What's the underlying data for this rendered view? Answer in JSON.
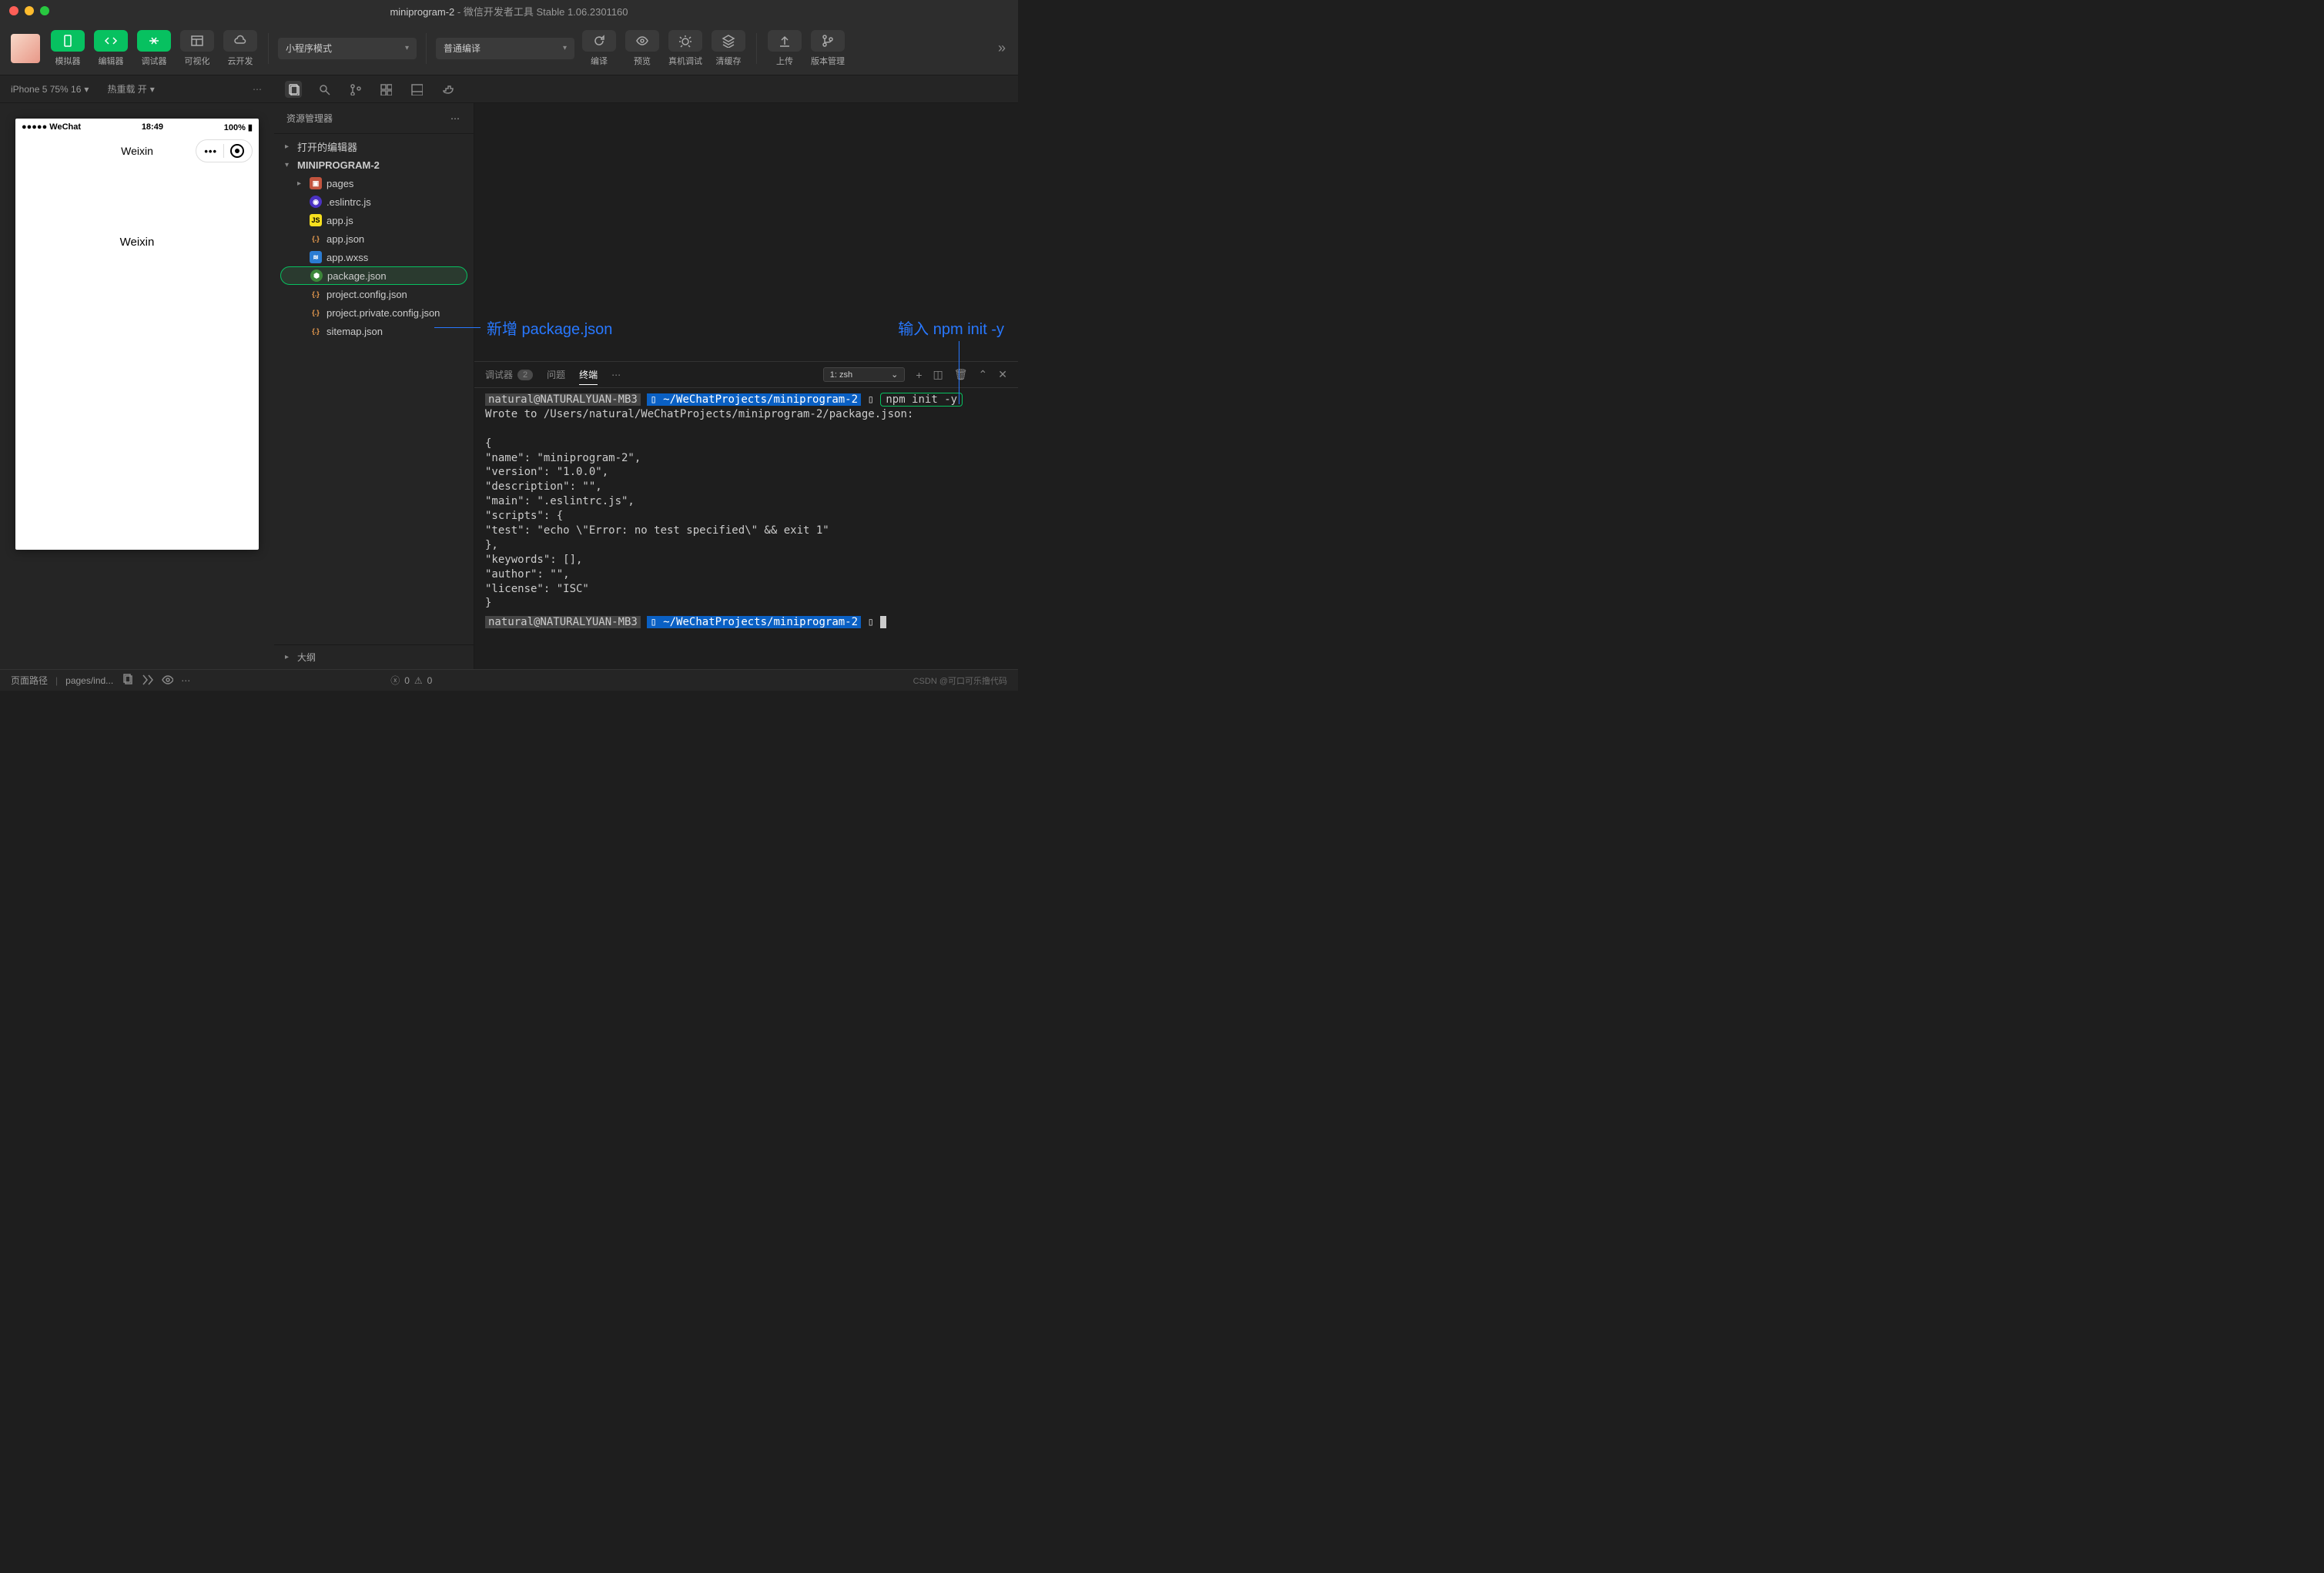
{
  "window": {
    "title_project": "miniprogram-2",
    "title_app": "微信开发者工具 Stable 1.06.2301160"
  },
  "toolbar": {
    "simulator": "模拟器",
    "editor": "编辑器",
    "debugger": "调试器",
    "visualize": "可视化",
    "cloud": "云开发",
    "mode_select": "小程序模式",
    "compile_select": "普通编译",
    "compile": "编译",
    "preview": "预览",
    "remote_debug": "真机调试",
    "clear_cache": "清缓存",
    "upload": "上传",
    "version_manage": "版本管理"
  },
  "subbar": {
    "device": "iPhone 5 75% 16",
    "hot_reload": "热重载 开"
  },
  "explorer": {
    "title": "资源管理器",
    "open_editors": "打开的编辑器",
    "project_root": "MINIPROGRAM-2",
    "outline": "大纲",
    "tree": [
      {
        "name": "pages",
        "icon": "folder",
        "kind": "dir"
      },
      {
        "name": ".eslintrc.js",
        "icon": "eslint",
        "kind": "file"
      },
      {
        "name": "app.js",
        "icon": "js",
        "kind": "file"
      },
      {
        "name": "app.json",
        "icon": "json",
        "kind": "file"
      },
      {
        "name": "app.wxss",
        "icon": "wxss",
        "kind": "file"
      },
      {
        "name": "package.json",
        "icon": "node",
        "kind": "file",
        "selected": true
      },
      {
        "name": "project.config.json",
        "icon": "json",
        "kind": "file"
      },
      {
        "name": "project.private.config.json",
        "icon": "json",
        "kind": "file"
      },
      {
        "name": "sitemap.json",
        "icon": "json",
        "kind": "file"
      }
    ]
  },
  "simulator_phone": {
    "carrier": "●●●●● WeChat",
    "time": "18:49",
    "battery": "100%",
    "nav_title": "Weixin",
    "body_text": "Weixin"
  },
  "annotations": {
    "a1": "新增  package.json",
    "a2": "输入 npm init -y"
  },
  "terminal": {
    "tabs": {
      "debugger": "调试器",
      "debugger_badge": "2",
      "problems": "问题",
      "terminal": "终端"
    },
    "shell_select": "1: zsh",
    "prompt_user": "natural@NATURALYUAN-MB3",
    "prompt_path": "~/WeChatProjects/miniprogram-2",
    "command": "npm init -y",
    "output_lines": [
      "Wrote to /Users/natural/WeChatProjects/miniprogram-2/package.json:",
      "",
      "{",
      "  \"name\": \"miniprogram-2\",",
      "  \"version\": \"1.0.0\",",
      "  \"description\": \"\",",
      "  \"main\": \".eslintrc.js\",",
      "  \"scripts\": {",
      "    \"test\": \"echo \\\"Error: no test specified\\\" && exit 1\"",
      "  },",
      "  \"keywords\": [],",
      "  \"author\": \"\",",
      "  \"license\": \"ISC\"",
      "}"
    ]
  },
  "statusbar": {
    "page_path_label": "页面路径",
    "page_path_value": "pages/ind...",
    "errors": "0",
    "warnings": "0",
    "watermark": "CSDN @可口可乐撸代码"
  }
}
